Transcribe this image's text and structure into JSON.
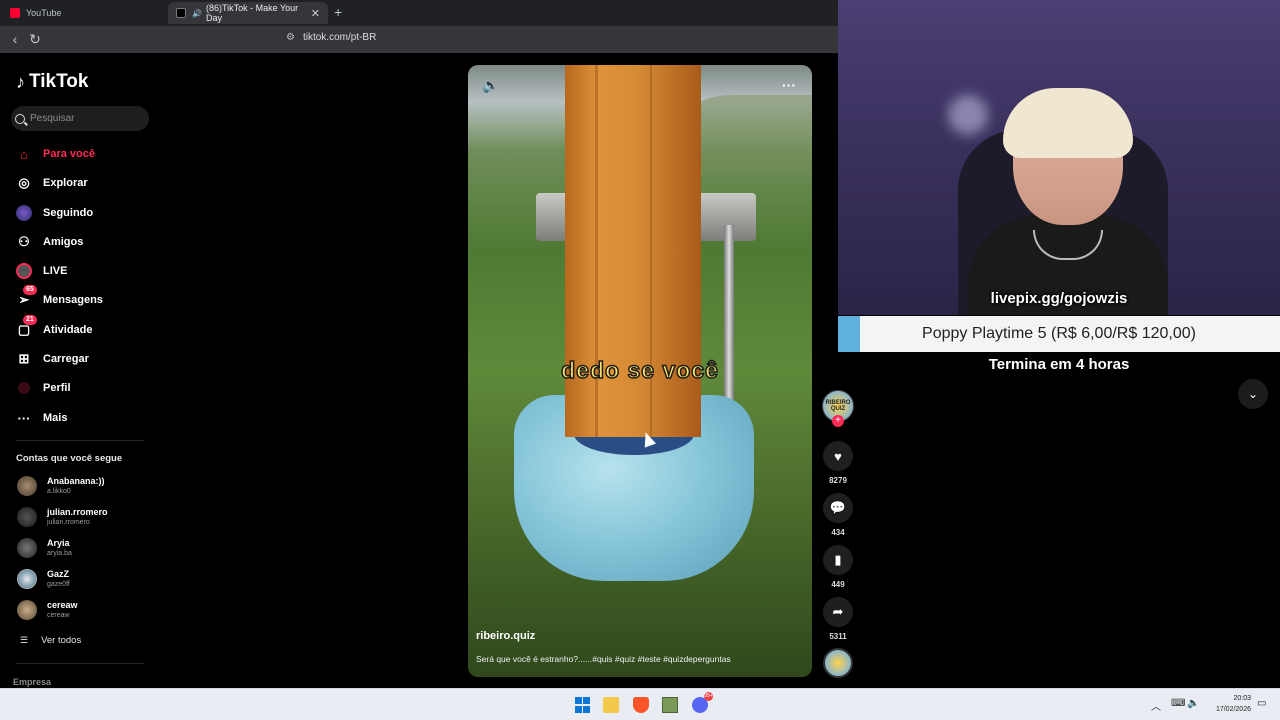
{
  "browser": {
    "tabs": [
      {
        "title": "YouTube"
      },
      {
        "title": "(86)TikTok - Make Your Day"
      }
    ],
    "new_tab": "+",
    "url": "tiktok.com/pt-BR"
  },
  "sidebar": {
    "logo": "TikTok",
    "search_placeholder": "Pesquisar",
    "nav": [
      {
        "label": "Para você",
        "icon": "home-icon",
        "active": true
      },
      {
        "label": "Explorar",
        "icon": "compass-icon"
      },
      {
        "label": "Seguindo",
        "icon": "following-icon"
      },
      {
        "label": "Amigos",
        "icon": "friends-icon"
      },
      {
        "label": "LIVE",
        "icon": "live-icon"
      },
      {
        "label": "Mensagens",
        "icon": "messages-icon",
        "badge": "65"
      },
      {
        "label": "Atividade",
        "icon": "activity-icon",
        "badge": "21"
      },
      {
        "label": "Carregar",
        "icon": "upload-icon"
      },
      {
        "label": "Perfil",
        "icon": "profile-icon"
      },
      {
        "label": "Mais",
        "icon": "more-icon"
      }
    ],
    "following_title": "Contas que você segue",
    "accounts": [
      {
        "name": "Anabanana:))",
        "handle": "a.likko0"
      },
      {
        "name": "julian.rromero",
        "handle": "julian.rromero"
      },
      {
        "name": "Aryia",
        "handle": "aryia.ba"
      },
      {
        "name": "GazZ",
        "handle": "gaze0ff"
      },
      {
        "name": "cereaw",
        "handle": "cereaw"
      }
    ],
    "see_all": "Ver todos",
    "company": "Empresa"
  },
  "video": {
    "overlay_text": "dedo se você",
    "username": "ribeiro.quiz",
    "description": "Será que você é estranho?......#quis #quiz #teste #quizdeperguntas",
    "author_badge": "RIBEIRO QUIZ"
  },
  "actions": {
    "likes": "8279",
    "comments": "434",
    "saves": "449",
    "shares": "5311"
  },
  "stream": {
    "livepix": "livepix.gg/gojowzis",
    "goal_text": "Poppy Playtime 5 (R$ 6,00/R$ 120,00)",
    "goal_progress": 0.05,
    "ends": "Termina em 4 horas"
  },
  "taskbar": {
    "discord_badge": "99+",
    "time": "20:03",
    "date": "17/02/2026"
  },
  "colors": {
    "accent": "#fe2c55",
    "goal_fill": "#5fb0dc"
  }
}
